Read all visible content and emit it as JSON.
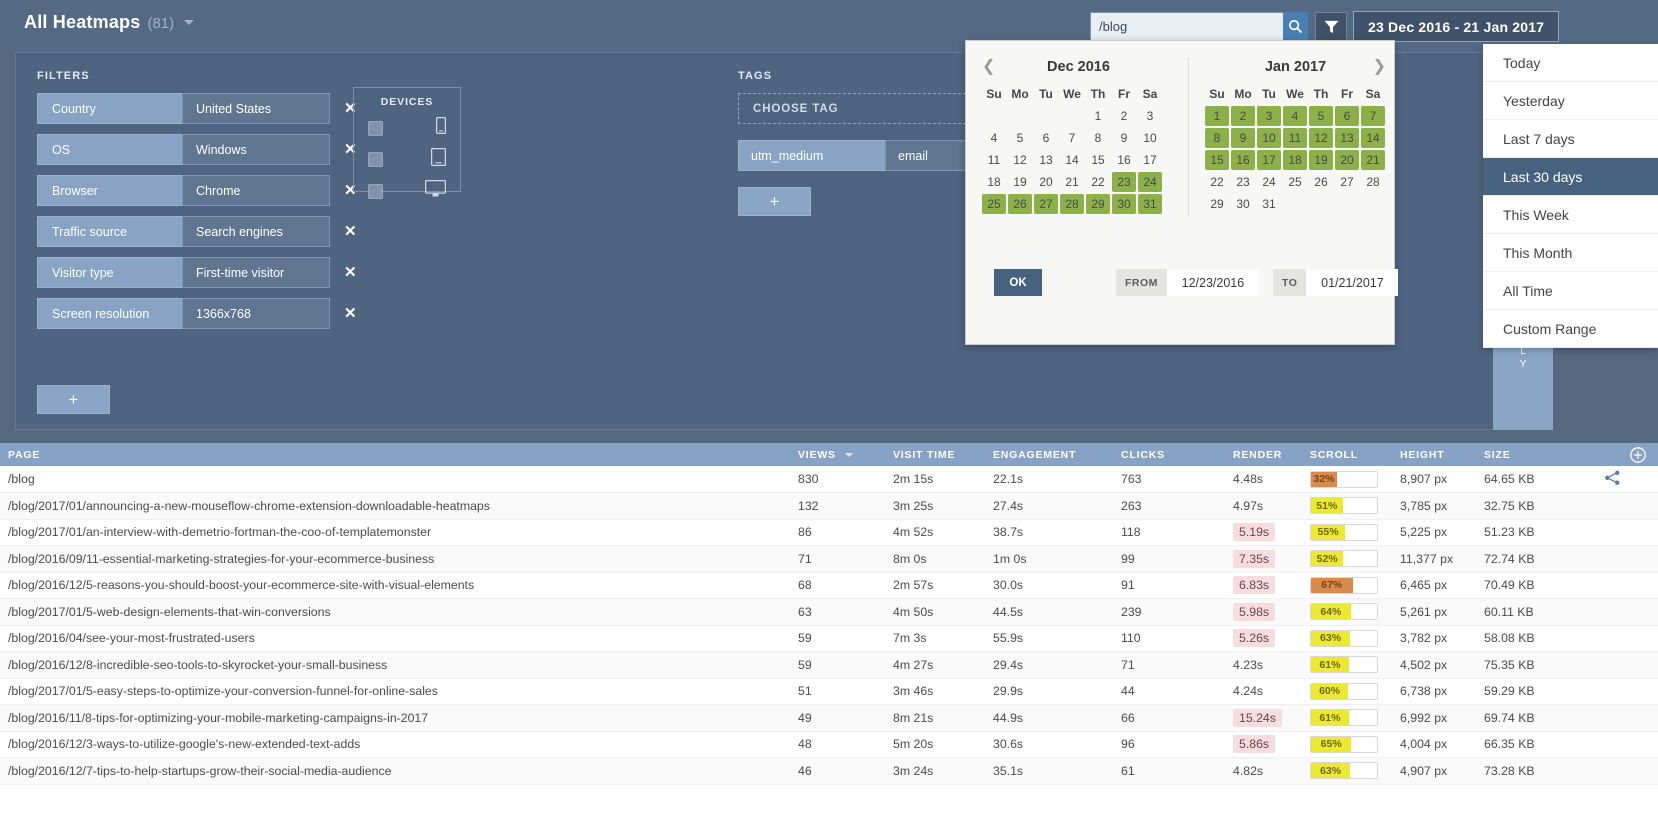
{
  "header": {
    "title": "All Heatmaps",
    "count": "(81)",
    "caret_icon": "chevron-down-icon",
    "search": {
      "value": "/blog",
      "placeholder": "Search",
      "icon": "search-icon"
    },
    "filter_icon": "funnel-icon",
    "date_range_label": "23 Dec 2016 - 21 Jan 2017"
  },
  "panel": {
    "filters_label": "FILTERS",
    "tags_label": "TAGS",
    "remove_icon": "close-icon",
    "add_label": "+",
    "filters": [
      {
        "key": "Country",
        "value": "United States"
      },
      {
        "key": "OS",
        "value": "Windows"
      },
      {
        "key": "Browser",
        "value": "Chrome"
      },
      {
        "key": "Traffic source",
        "value": "Search engines"
      },
      {
        "key": "Visitor type",
        "value": "First-time visitor"
      },
      {
        "key": "Screen resolution",
        "value": "1366x768"
      }
    ],
    "devices": {
      "title": "DEVICES",
      "items": [
        {
          "icon": "mobile-icon",
          "checked": false
        },
        {
          "icon": "tablet-icon",
          "checked": false
        },
        {
          "icon": "desktop-icon",
          "checked": false
        }
      ]
    },
    "tags": {
      "choose_label": "CHOOSE TAG",
      "rows": [
        {
          "key": "utm_medium",
          "value": "email"
        }
      ]
    },
    "side_strip_text": "L\nY"
  },
  "datepicker": {
    "left": {
      "month_label": "Dec 2016",
      "prev_icon": "chevron-left-icon",
      "weekdays": [
        "Su",
        "Mo",
        "Tu",
        "We",
        "Th",
        "Fr",
        "Sa"
      ],
      "weeks": [
        [
          {
            "d": "",
            "t": "emp"
          },
          {
            "d": "",
            "t": "emp"
          },
          {
            "d": "",
            "t": "emp"
          },
          {
            "d": "",
            "t": "emp"
          },
          {
            "d": "1",
            "t": ""
          },
          {
            "d": "2",
            "t": ""
          },
          {
            "d": "3",
            "t": ""
          }
        ],
        [
          {
            "d": "4",
            "t": ""
          },
          {
            "d": "5",
            "t": ""
          },
          {
            "d": "6",
            "t": ""
          },
          {
            "d": "7",
            "t": ""
          },
          {
            "d": "8",
            "t": ""
          },
          {
            "d": "9",
            "t": ""
          },
          {
            "d": "10",
            "t": ""
          }
        ],
        [
          {
            "d": "11",
            "t": ""
          },
          {
            "d": "12",
            "t": ""
          },
          {
            "d": "13",
            "t": ""
          },
          {
            "d": "14",
            "t": ""
          },
          {
            "d": "15",
            "t": ""
          },
          {
            "d": "16",
            "t": ""
          },
          {
            "d": "17",
            "t": ""
          }
        ],
        [
          {
            "d": "18",
            "t": ""
          },
          {
            "d": "19",
            "t": ""
          },
          {
            "d": "20",
            "t": ""
          },
          {
            "d": "21",
            "t": ""
          },
          {
            "d": "22",
            "t": ""
          },
          {
            "d": "23",
            "t": "sel"
          },
          {
            "d": "24",
            "t": "sel"
          }
        ],
        [
          {
            "d": "25",
            "t": "sel"
          },
          {
            "d": "26",
            "t": "sel"
          },
          {
            "d": "27",
            "t": "sel"
          },
          {
            "d": "28",
            "t": "sel"
          },
          {
            "d": "29",
            "t": "sel"
          },
          {
            "d": "30",
            "t": "sel"
          },
          {
            "d": "31",
            "t": "sel"
          }
        ]
      ]
    },
    "right": {
      "month_label": "Jan 2017",
      "next_icon": "chevron-right-icon",
      "weekdays": [
        "Su",
        "Mo",
        "Tu",
        "We",
        "Th",
        "Fr",
        "Sa"
      ],
      "weeks": [
        [
          {
            "d": "1",
            "t": "sel"
          },
          {
            "d": "2",
            "t": "sel"
          },
          {
            "d": "3",
            "t": "sel"
          },
          {
            "d": "4",
            "t": "sel"
          },
          {
            "d": "5",
            "t": "sel"
          },
          {
            "d": "6",
            "t": "sel"
          },
          {
            "d": "7",
            "t": "sel"
          }
        ],
        [
          {
            "d": "8",
            "t": "sel"
          },
          {
            "d": "9",
            "t": "sel"
          },
          {
            "d": "10",
            "t": "sel"
          },
          {
            "d": "11",
            "t": "sel"
          },
          {
            "d": "12",
            "t": "sel"
          },
          {
            "d": "13",
            "t": "sel"
          },
          {
            "d": "14",
            "t": "sel"
          }
        ],
        [
          {
            "d": "15",
            "t": "sel"
          },
          {
            "d": "16",
            "t": "sel"
          },
          {
            "d": "17",
            "t": "sel"
          },
          {
            "d": "18",
            "t": "sel"
          },
          {
            "d": "19",
            "t": "sel"
          },
          {
            "d": "20",
            "t": "sel"
          },
          {
            "d": "21",
            "t": "sel"
          }
        ],
        [
          {
            "d": "22",
            "t": "mut"
          },
          {
            "d": "23",
            "t": "mut"
          },
          {
            "d": "24",
            "t": "mut"
          },
          {
            "d": "25",
            "t": "mut"
          },
          {
            "d": "26",
            "t": "mut"
          },
          {
            "d": "27",
            "t": "mut"
          },
          {
            "d": "28",
            "t": "mut"
          }
        ],
        [
          {
            "d": "29",
            "t": "mut"
          },
          {
            "d": "30",
            "t": "mut"
          },
          {
            "d": "31",
            "t": "mut"
          },
          {
            "d": "",
            "t": "emp"
          },
          {
            "d": "",
            "t": "emp"
          },
          {
            "d": "",
            "t": "emp"
          },
          {
            "d": "",
            "t": "emp"
          }
        ]
      ]
    },
    "ok_label": "OK",
    "from_label": "FROM",
    "from_value": "12/23/2016",
    "to_label": "TO",
    "to_value": "01/21/2017",
    "selected_color": "#8cb04a"
  },
  "presets": [
    {
      "label": "Today",
      "active": false
    },
    {
      "label": "Yesterday",
      "active": false
    },
    {
      "label": "Last 7 days",
      "active": false
    },
    {
      "label": "Last 30 days",
      "active": true
    },
    {
      "label": "This Week",
      "active": false
    },
    {
      "label": "This Month",
      "active": false
    },
    {
      "label": "All Time",
      "active": false
    },
    {
      "label": "Custom Range",
      "active": false
    }
  ],
  "table": {
    "columns": [
      "PAGE",
      "VIEWS",
      "VISIT TIME",
      "ENGAGEMENT",
      "CLICKS",
      "RENDER",
      "SCROLL",
      "HEIGHT",
      "SIZE"
    ],
    "sorted_column": "VIEWS",
    "sort_icon": "caret-down-icon",
    "add_column_icon": "plus-circle-icon",
    "share_icon": "share-icon",
    "rows": [
      {
        "page": "/blog",
        "views": "830",
        "visit_time": "2m 15s",
        "engagement": "22.1s",
        "clicks": "763",
        "render": "4.48s",
        "render_slow": false,
        "scroll": "32%",
        "scroll_pct": 32,
        "scroll_color": "o",
        "height": "8,907 px",
        "size": "64.65 KB",
        "share": true
      },
      {
        "page": "/blog/2017/01/announcing-a-new-mouseflow-chrome-extension-downloadable-heatmaps",
        "views": "132",
        "visit_time": "3m 25s",
        "engagement": "27.4s",
        "clicks": "263",
        "render": "4.97s",
        "render_slow": false,
        "scroll": "51%",
        "scroll_pct": 51,
        "scroll_color": "y",
        "height": "3,785 px",
        "size": "32.75 KB",
        "share": false
      },
      {
        "page": "/blog/2017/01/an-interview-with-demetrio-fortman-the-coo-of-templatemonster",
        "views": "86",
        "visit_time": "4m 52s",
        "engagement": "38.7s",
        "clicks": "118",
        "render": "5.19s",
        "render_slow": true,
        "scroll": "55%",
        "scroll_pct": 55,
        "scroll_color": "y",
        "height": "5,225 px",
        "size": "51.23 KB",
        "share": false
      },
      {
        "page": "/blog/2016/09/11-essential-marketing-strategies-for-your-ecommerce-business",
        "views": "71",
        "visit_time": "8m 0s",
        "engagement": "1m 0s",
        "clicks": "99",
        "render": "7.35s",
        "render_slow": true,
        "scroll": "52%",
        "scroll_pct": 52,
        "scroll_color": "y",
        "height": "11,377 px",
        "size": "72.74 KB",
        "share": false
      },
      {
        "page": "/blog/2016/12/5-reasons-you-should-boost-your-ecommerce-site-with-visual-elements",
        "views": "68",
        "visit_time": "2m 57s",
        "engagement": "30.0s",
        "clicks": "91",
        "render": "6.83s",
        "render_slow": true,
        "scroll": "67%",
        "scroll_pct": 67,
        "scroll_color": "o",
        "height": "6,465 px",
        "size": "70.49 KB",
        "share": false
      },
      {
        "page": "/blog/2017/01/5-web-design-elements-that-win-conversions",
        "views": "63",
        "visit_time": "4m 50s",
        "engagement": "44.5s",
        "clicks": "239",
        "render": "5.98s",
        "render_slow": true,
        "scroll": "64%",
        "scroll_pct": 64,
        "scroll_color": "y",
        "height": "5,261 px",
        "size": "60.11 KB",
        "share": false
      },
      {
        "page": "/blog/2016/04/see-your-most-frustrated-users",
        "views": "59",
        "visit_time": "7m 3s",
        "engagement": "55.9s",
        "clicks": "110",
        "render": "5.26s",
        "render_slow": true,
        "scroll": "63%",
        "scroll_pct": 63,
        "scroll_color": "y",
        "height": "3,782 px",
        "size": "58.08 KB",
        "share": false
      },
      {
        "page": "/blog/2016/12/8-incredible-seo-tools-to-skyrocket-your-small-business",
        "views": "59",
        "visit_time": "4m 27s",
        "engagement": "29.4s",
        "clicks": "71",
        "render": "4.23s",
        "render_slow": false,
        "scroll": "61%",
        "scroll_pct": 61,
        "scroll_color": "y",
        "height": "4,502 px",
        "size": "75.35 KB",
        "share": false
      },
      {
        "page": "/blog/2017/01/5-easy-steps-to-optimize-your-conversion-funnel-for-online-sales",
        "views": "51",
        "visit_time": "3m 46s",
        "engagement": "29.9s",
        "clicks": "44",
        "render": "4.24s",
        "render_slow": false,
        "scroll": "60%",
        "scroll_pct": 60,
        "scroll_color": "y",
        "height": "6,738 px",
        "size": "59.29 KB",
        "share": false
      },
      {
        "page": "/blog/2016/11/8-tips-for-optimizing-your-mobile-marketing-campaigns-in-2017",
        "views": "49",
        "visit_time": "8m 21s",
        "engagement": "44.9s",
        "clicks": "66",
        "render": "15.24s",
        "render_slow": true,
        "scroll": "61%",
        "scroll_pct": 61,
        "scroll_color": "y",
        "height": "6,992 px",
        "size": "69.74 KB",
        "share": false
      },
      {
        "page": "/blog/2016/12/3-ways-to-utilize-google's-new-extended-text-adds",
        "views": "48",
        "visit_time": "5m 20s",
        "engagement": "30.6s",
        "clicks": "96",
        "render": "5.86s",
        "render_slow": true,
        "scroll": "65%",
        "scroll_pct": 65,
        "scroll_color": "y",
        "height": "4,004 px",
        "size": "66.35 KB",
        "share": false
      },
      {
        "page": "/blog/2016/12/7-tips-to-help-startups-grow-their-social-media-audience",
        "views": "46",
        "visit_time": "3m 24s",
        "engagement": "35.1s",
        "clicks": "61",
        "render": "4.82s",
        "render_slow": false,
        "scroll": "63%",
        "scroll_pct": 63,
        "scroll_color": "y",
        "height": "4,907 px",
        "size": "73.28 KB",
        "share": false
      }
    ]
  }
}
